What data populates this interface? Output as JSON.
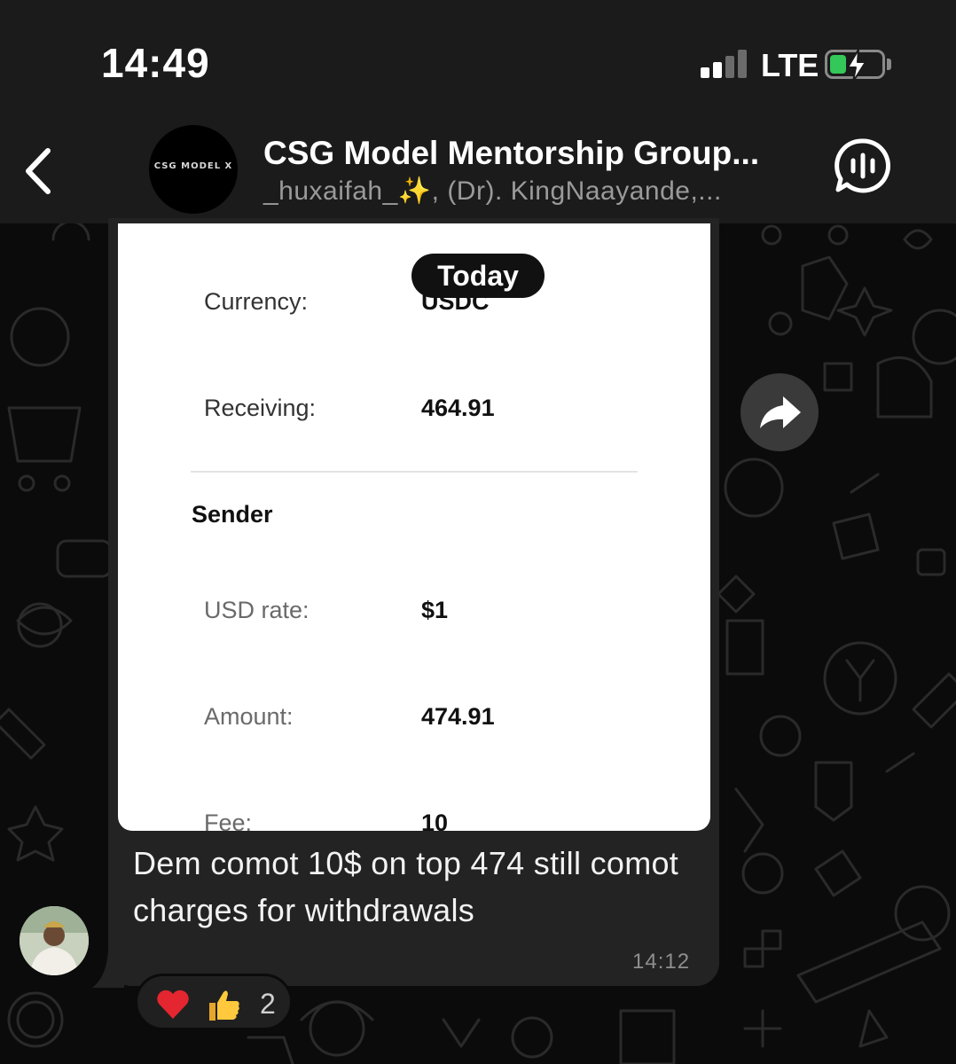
{
  "status_bar": {
    "time": "14:49",
    "network": "LTE",
    "battery_charging": true,
    "signal_bars_active": 2,
    "signal_bars_total": 4
  },
  "chat": {
    "group_name": "CSG Model Mentorship Group...",
    "members": "_huxaifah_✨, (Dr). KingNaayande,...",
    "avatar_text": "CSG MODEL X"
  },
  "date_chip": "Today",
  "receipt": {
    "rows": [
      {
        "label": "Currency:",
        "value": "USDC"
      },
      {
        "label": "Receiving:",
        "value": "464.91"
      }
    ],
    "section_title": "Sender",
    "sender_rows": [
      {
        "label": "USD rate:",
        "value": "$1"
      },
      {
        "label": "Amount:",
        "value": "474.91"
      },
      {
        "label": "Fee:",
        "value": "10"
      }
    ]
  },
  "message": {
    "text": "Dem comot 10$ on top 474 still comot charges for withdrawals",
    "time": "14:12"
  },
  "reactions": {
    "emojis": [
      "heart",
      "thumbs-up"
    ],
    "count": "2"
  },
  "colors": {
    "background": "#0b0b0b",
    "header": "#1b1b1b",
    "bubble": "#232323",
    "battery_green": "#34c759",
    "heart_red": "#e3262f"
  }
}
